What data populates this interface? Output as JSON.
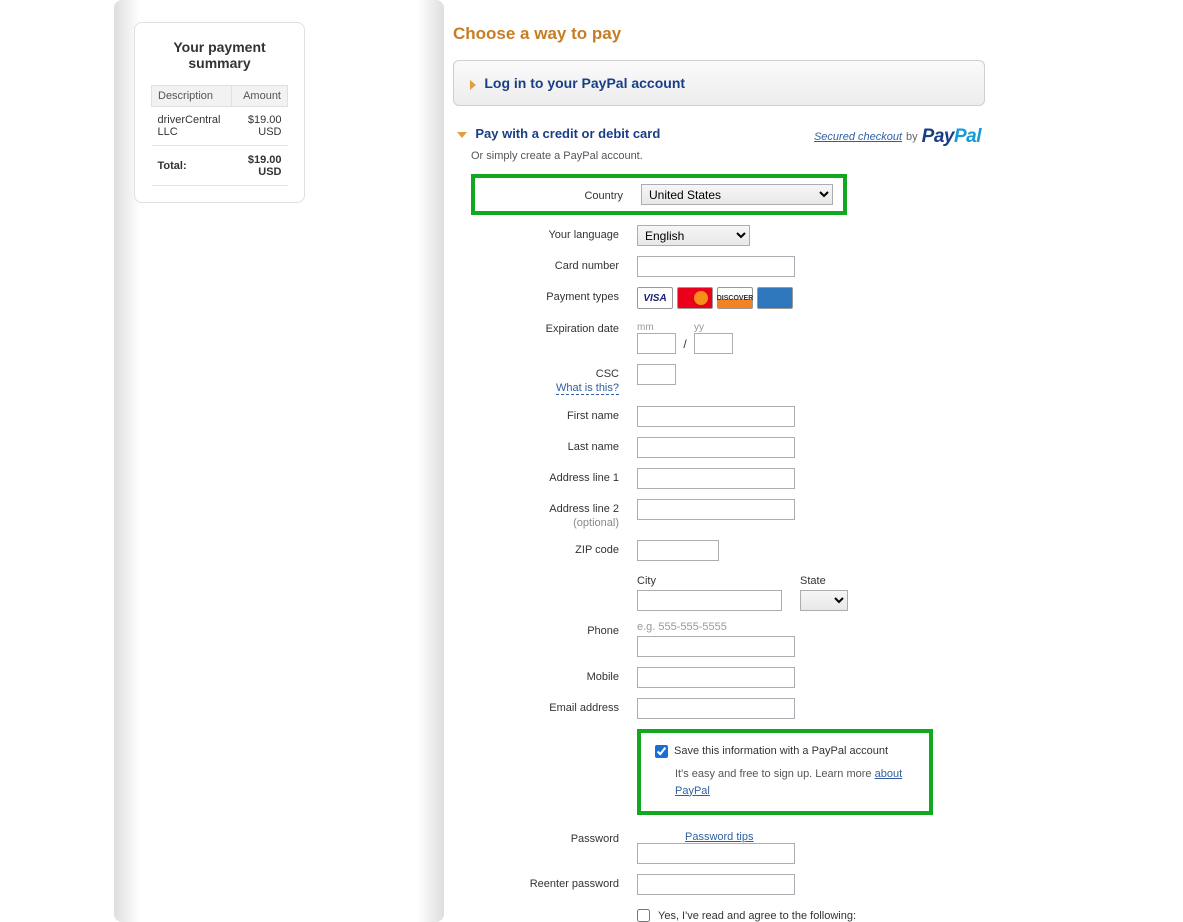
{
  "summary": {
    "title": "Your payment summary",
    "col_desc": "Description",
    "col_amt": "Amount",
    "item_desc": "driverCentral LLC",
    "item_amt": "$19.00 USD",
    "total_label": "Total:",
    "total_amt": "$19.00 USD"
  },
  "main": {
    "heading": "Choose a way to pay",
    "login_panel": "Log in to your PayPal account",
    "card_title": "Pay with a credit or debit card",
    "card_sub": "Or simply create a PayPal account.",
    "secured": "Secured checkout",
    "by": "by",
    "pp1": "Pay",
    "pp2": "Pal"
  },
  "form": {
    "country_label": "Country",
    "country_value": "United States",
    "lang_label": "Your language",
    "lang_value": "English",
    "cardnum_label": "Card number",
    "paytypes_label": "Payment types",
    "exp_label": "Expiration date",
    "exp_mm": "mm",
    "exp_yy": "yy",
    "csc_label": "CSC",
    "csc_help": "What is this?",
    "fname_label": "First name",
    "lname_label": "Last name",
    "addr1_label": "Address line 1",
    "addr2_label": "Address line 2",
    "optional": "(optional)",
    "zip_label": "ZIP code",
    "city_label": "City",
    "state_label": "State",
    "phone_label": "Phone",
    "phone_hint": "e.g. 555-555-5555",
    "mobile_label": "Mobile",
    "email_label": "Email address",
    "save_label": "Save this information with a PayPal account",
    "save_sub": "It's easy and free to sign up. Learn more ",
    "about_pp": "about PayPal",
    "pwd_label": "Password",
    "pwd_tips": "Password tips",
    "repwd_label": "Reenter password",
    "agree_label": "Yes, I've read and agree to the following:",
    "visa": "VISA",
    "disc": "DISCOVER"
  }
}
